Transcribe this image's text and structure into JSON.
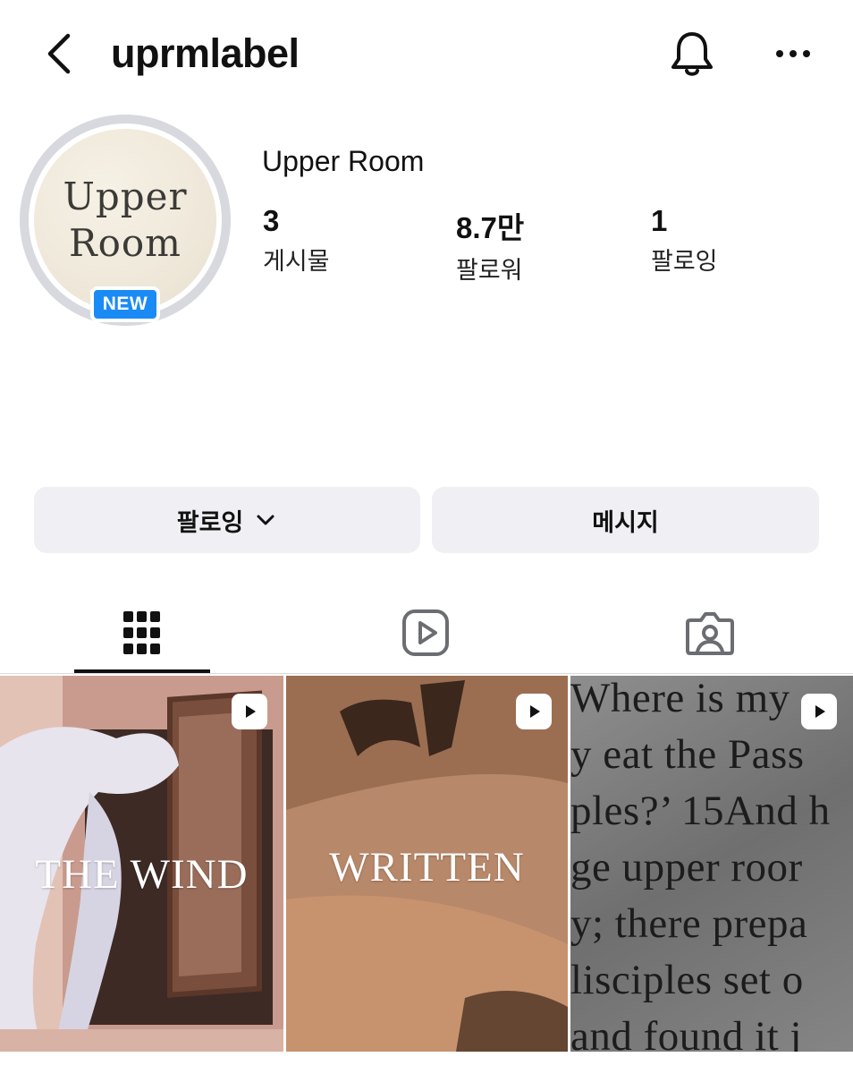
{
  "header": {
    "username": "uprmlabel"
  },
  "profile": {
    "logo_line1": "Upper",
    "logo_line2": "Room",
    "badge": "NEW",
    "display_name": "Upper Room",
    "stats": [
      {
        "value": "3",
        "label": "게시물"
      },
      {
        "value": "8.7만",
        "label": "팔로워"
      },
      {
        "value": "1",
        "label": "팔로잉"
      }
    ]
  },
  "actions": {
    "follow_label": "팔로잉",
    "message_label": "메시지"
  },
  "tabs": {
    "icons": [
      "grid-icon",
      "reels-icon",
      "tagged-icon"
    ],
    "active": "grid"
  },
  "posts": [
    {
      "caption": "THE WIND",
      "type": "reel"
    },
    {
      "caption": "WRITTEN",
      "type": "reel"
    },
    {
      "type": "reel",
      "lines": [
        "Where is my",
        "y eat the Pass",
        "ples?’ 15And h",
        "ge upper roor",
        "y; there prepa",
        "lisciples set o",
        "and found it j"
      ]
    }
  ]
}
